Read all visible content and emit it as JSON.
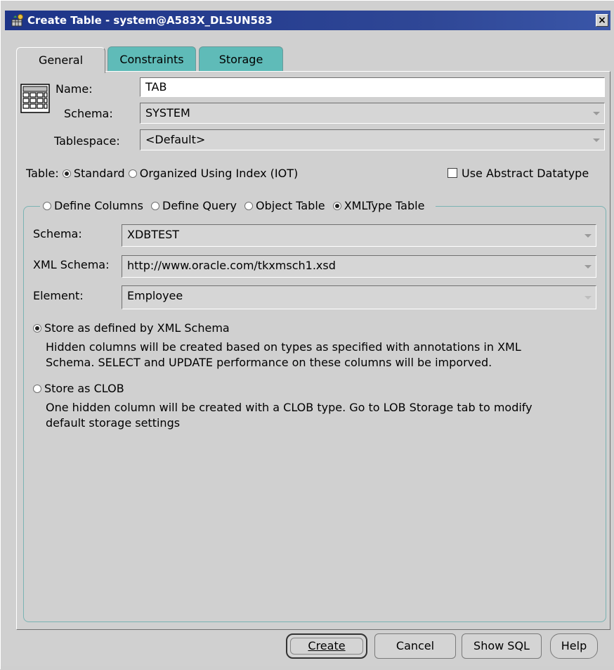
{
  "window": {
    "title": "Create Table - system@A583X_DLSUN583",
    "close_glyph": "×"
  },
  "tabs": [
    {
      "label": "General",
      "active": true
    },
    {
      "label": "Constraints",
      "active": false
    },
    {
      "label": "Storage",
      "active": false
    }
  ],
  "general": {
    "name_label": "Name:",
    "name_value": "TAB",
    "schema_label": "Schema:",
    "schema_value": "SYSTEM",
    "tablespace_label": "Tablespace:",
    "tablespace_value": "<Default>",
    "table_label": "Table:",
    "table_options": [
      {
        "label": "Standard",
        "selected": true
      },
      {
        "label": "Organized Using Index (IOT)",
        "selected": false
      }
    ],
    "abstract_datatype_label": "Use Abstract Datatype",
    "abstract_datatype_checked": false
  },
  "definition": {
    "options": [
      {
        "label": "Define Columns",
        "selected": false
      },
      {
        "label": "Define Query",
        "selected": false
      },
      {
        "label": "Object Table",
        "selected": false
      },
      {
        "label": "XMLType Table",
        "selected": true
      }
    ],
    "schema_label": "Schema:",
    "schema_value": "XDBTEST",
    "xml_schema_label": "XML Schema:",
    "xml_schema_value": "http://www.oracle.com/tkxmsch1.xsd",
    "element_label": "Element:",
    "element_value": "Employee",
    "store_xml_label": "Store as defined by XML Schema",
    "store_xml_selected": true,
    "store_xml_desc_1": "Hidden columns will be created based on types as specified with annotations in XML",
    "store_xml_desc_2": "Schema. SELECT and UPDATE performance on these columns will be imporved.",
    "store_clob_label": "Store as CLOB",
    "store_clob_selected": false,
    "store_clob_desc_1": "One hidden column will be created with a CLOB type. Go to LOB Storage tab to modify",
    "store_clob_desc_2": "default storage settings"
  },
  "buttons": {
    "create": "Create",
    "cancel": "Cancel",
    "show_sql": "Show SQL",
    "help": "Help"
  },
  "icons": {
    "title": "table-wizard-icon",
    "table": "table-grid-icon"
  }
}
